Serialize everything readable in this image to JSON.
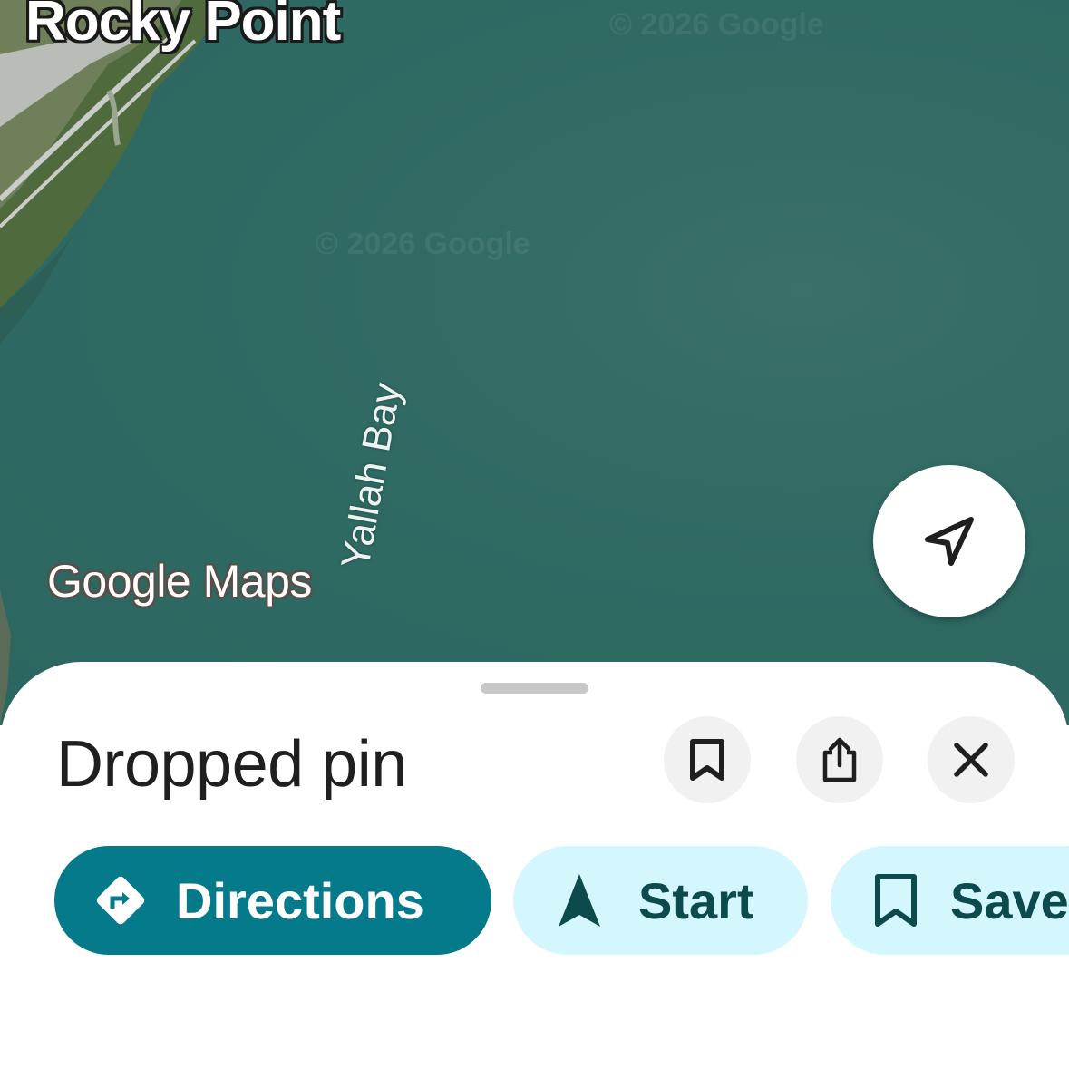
{
  "map": {
    "place_label": "Rocky Point",
    "bay_label": "Yallah Bay",
    "logo_text": "Google Maps",
    "watermark": "© 2026 Google",
    "water_color": "#2f6a63",
    "locate_icon": "navigation-arrow-icon"
  },
  "sheet": {
    "title": "Dropped pin",
    "actions": [
      {
        "name": "save",
        "icon": "bookmark-icon"
      },
      {
        "name": "share",
        "icon": "share-icon"
      },
      {
        "name": "close",
        "icon": "close-icon"
      }
    ],
    "chips": {
      "directions": "Directions",
      "start": "Start",
      "save": "Save"
    },
    "colors": {
      "primary": "#047a8a",
      "secondary": "#d3f7fd",
      "secondary_text": "#0c4a4e"
    }
  }
}
